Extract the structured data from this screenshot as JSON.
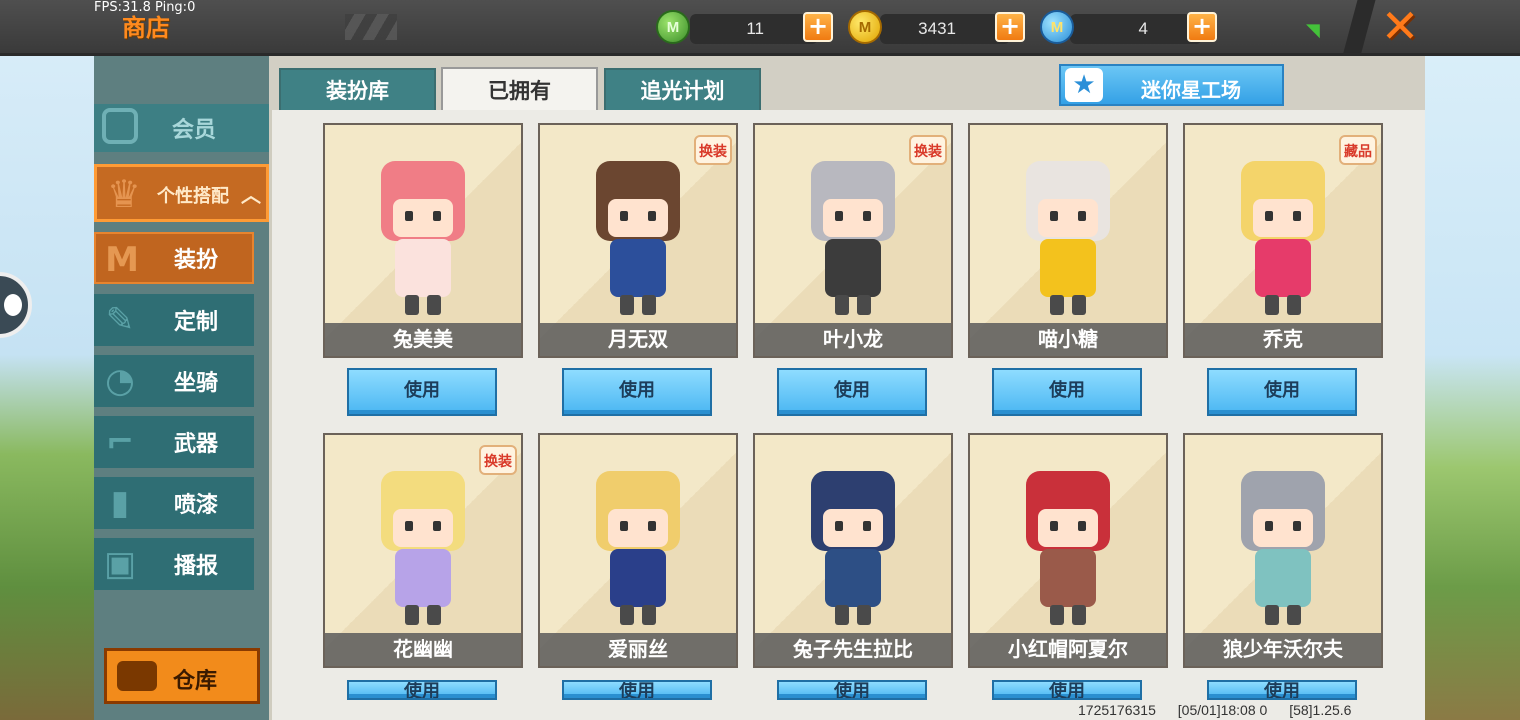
{
  "hud": {
    "fps_text": "FPS:31.8  Ping:0"
  },
  "header": {
    "title": "商店"
  },
  "currencies": [
    {
      "icon": "green-gem-icon",
      "value": "11"
    },
    {
      "icon": "gold-coin-icon",
      "value": "3431"
    },
    {
      "icon": "blue-coin-icon",
      "value": "4"
    }
  ],
  "sidebar": {
    "member_label": "会员",
    "group_label": "个性搭配",
    "items": [
      {
        "label": "装扮",
        "icon": "shirt-icon",
        "active": true
      },
      {
        "label": "定制",
        "icon": "brush-icon",
        "active": false
      },
      {
        "label": "坐骑",
        "icon": "saddle-icon",
        "active": false
      },
      {
        "label": "武器",
        "icon": "revolver-icon",
        "active": false
      },
      {
        "label": "喷漆",
        "icon": "spray-can-icon",
        "active": false
      },
      {
        "label": "播报",
        "icon": "gift-box-icon",
        "active": false
      }
    ],
    "warehouse_label": "仓库"
  },
  "tabs": [
    {
      "label": "装扮库",
      "active": false
    },
    {
      "label": "已拥有",
      "active": true
    },
    {
      "label": "追光计划",
      "active": false
    }
  ],
  "mini_workshop_label": "迷你星工场",
  "skins": [
    {
      "name": "兔美美",
      "tag": "",
      "button": "使用",
      "hair": "#f07d86",
      "outfit": "#fbe2dd"
    },
    {
      "name": "月无双",
      "tag": "换装",
      "button": "使用",
      "hair": "#6b4630",
      "outfit": "#2c4f9b"
    },
    {
      "name": "叶小龙",
      "tag": "换装",
      "button": "使用",
      "hair": "#b8b8bf",
      "outfit": "#3c3c3c"
    },
    {
      "name": "喵小糖",
      "tag": "",
      "button": "使用",
      "hair": "#e9e4e0",
      "outfit": "#f3c21d"
    },
    {
      "name": "乔克",
      "tag": "藏品",
      "button": "使用",
      "hair": "#f4d46a",
      "outfit": "#e63b6a"
    },
    {
      "name": "花幽幽",
      "tag": "换装",
      "button": "使用",
      "hair": "#f3dc7e",
      "outfit": "#b7a3e8"
    },
    {
      "name": "爱丽丝",
      "tag": "",
      "button": "使用",
      "hair": "#f0cd6c",
      "outfit": "#2a3f8a"
    },
    {
      "name": "兔子先生拉比",
      "tag": "",
      "button": "使用",
      "hair": "#2d3f70",
      "outfit": "#2d4f85"
    },
    {
      "name": "小红帽阿夏尔",
      "tag": "",
      "button": "使用",
      "hair": "#c9303a",
      "outfit": "#9a5a4a"
    },
    {
      "name": "狼少年沃尔夫",
      "tag": "",
      "button": "使用",
      "hair": "#9fa3ad",
      "outfit": "#7fc2c0"
    }
  ],
  "footer": {
    "uid": "1725176315",
    "timestamp": "[05/01]18:08 0",
    "version": "[58]1.25.6"
  }
}
